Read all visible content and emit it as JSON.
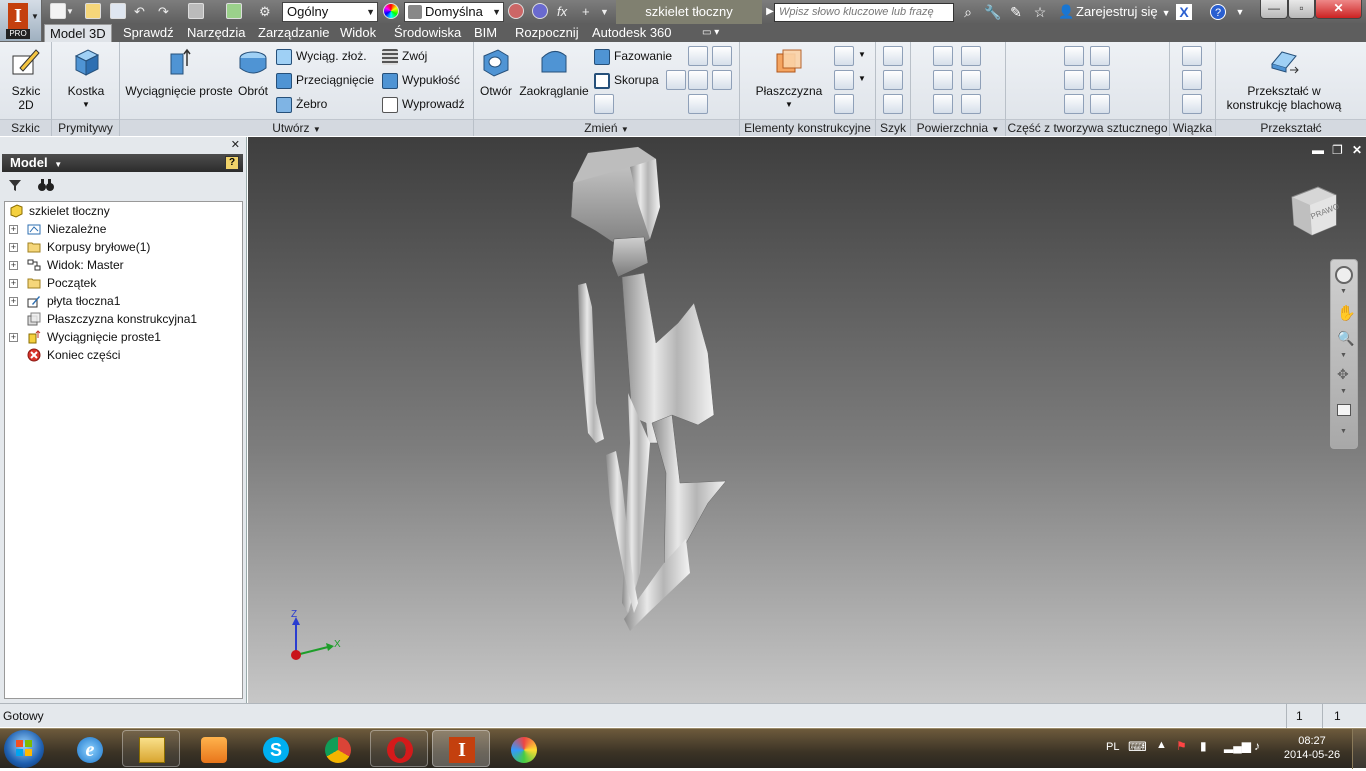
{
  "app": {
    "logo_text": "I",
    "logo_badge": "PRO",
    "document_title": "szkielet tłoczny",
    "search_placeholder": "Wpisz słowo kluczowe lub frazę",
    "signin_label": "Zarejestruj się",
    "material_combo": "Ogólny",
    "appearance_combo": "Domyślna"
  },
  "tabs": [
    "Model 3D",
    "Sprawdź",
    "Narzędzia",
    "Zarządzanie",
    "Widok",
    "Środowiska",
    "BIM",
    "Rozpocznij",
    "Autodesk 360"
  ],
  "ribbon": {
    "sketch": {
      "button": "Szkic 2D",
      "title": "Szkic"
    },
    "primitives": {
      "button": "Kostka",
      "title": "Prymitywy"
    },
    "create": {
      "title": "Utwórz",
      "extrude": "Wyciągnięcie proste",
      "revolve": "Obrót",
      "loft": "Wyciąg. złoż.",
      "sweep": "Przeciągnięcie",
      "rib": "Żebro",
      "coil": "Zwój",
      "emboss": "Wypukłość",
      "derive": "Wyprowadź"
    },
    "modify": {
      "title": "Zmień",
      "hole": "Otwór",
      "fillet": "Zaokrąglanie",
      "chamfer": "Fazowanie",
      "shell": "Skorupa"
    },
    "work_features": {
      "title": "Elementy konstrukcyjne",
      "plane": "Płaszczyzna"
    },
    "pattern": {
      "title": "Szyk"
    },
    "surface": {
      "title": "Powierzchnia"
    },
    "plastic": {
      "title": "Część z tworzywa sztucznego"
    },
    "harness": {
      "title": "Wiązka"
    },
    "convert": {
      "title": "Przekształć",
      "button": "Przekształć w konstrukcję blachową"
    }
  },
  "browser": {
    "header": "Model",
    "tree": [
      {
        "label": "szkielet tłoczny",
        "icon": "part-icon",
        "expandable": false
      },
      {
        "label": "Niezależne",
        "icon": "solid-bodies-icon",
        "expandable": true
      },
      {
        "label": "Korpusy bryłowe(1)",
        "icon": "folder-icon",
        "expandable": true
      },
      {
        "label": "Widok: Master",
        "icon": "view-rep-icon",
        "expandable": true
      },
      {
        "label": "Początek",
        "icon": "origin-folder-icon",
        "expandable": true
      },
      {
        "label": "płyta tłoczna1",
        "icon": "sketch-icon",
        "expandable": true
      },
      {
        "label": "Płaszczyzna konstrukcyjna1",
        "icon": "work-plane-icon",
        "expandable": false
      },
      {
        "label": "Wyciągnięcie proste1",
        "icon": "extrude-icon",
        "expandable": true
      },
      {
        "label": "Koniec części",
        "icon": "end-of-part-icon",
        "expandable": false
      }
    ]
  },
  "viewport": {
    "viewcube_label": "PRAWO",
    "axis_z": "Z",
    "axis_x": "X"
  },
  "status": {
    "text": "Gotowy",
    "count1": "1",
    "count2": "1"
  },
  "taskbar": {
    "language": "PL",
    "time": "08:27",
    "date": "2014-05-26",
    "apps": [
      "explorer-icon",
      "internet-explorer-icon",
      "media-player-icon",
      "skype-icon",
      "chrome-icon",
      "opera-icon",
      "inventor-icon",
      "paint-icon"
    ]
  },
  "colors": {
    "accent_tab": "#dfe3e8",
    "title_bar": "#6a6a6a",
    "inventor_logo": "#c4400e"
  }
}
